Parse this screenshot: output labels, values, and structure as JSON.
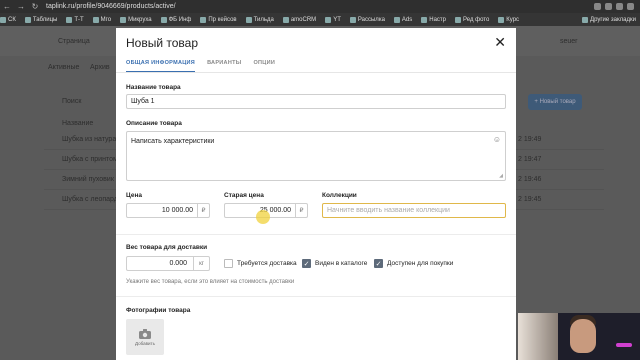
{
  "browser": {
    "url": "taplink.ru/profile/9046669/products/active/",
    "bookmarks": [
      "СК",
      "Таблицы",
      "Т-Т",
      "Мго",
      "Микруха",
      "ФБ Инф",
      "Пр кейсов",
      "Тильда",
      "amoCRM",
      "YT",
      "Рассылка",
      "Ads",
      "Настр",
      "Ред фото",
      "Курс"
    ],
    "other_bookmarks": "Другие закладки"
  },
  "background_app": {
    "nav_pages": "Страница",
    "user": "seuer",
    "tabs": [
      "Активные",
      "Архив"
    ],
    "search_placeholder": "Поиск",
    "new_product_button": "+ Новый товар",
    "column_name": "Название",
    "rows": [
      {
        "name": "Шубка из натурально",
        "date": "2 19:49"
      },
      {
        "name": "Шубка с принтом",
        "date": "2 19:47"
      },
      {
        "name": "Зимний пуховик с",
        "date": "2 19:46"
      },
      {
        "name": "Шубка с леопардо",
        "date": "2 19:45"
      }
    ]
  },
  "modal": {
    "title": "Новый товар",
    "tabs": [
      {
        "label": "ОБЩАЯ ИНФОРМАЦИЯ",
        "active": true
      },
      {
        "label": "ВАРИАНТЫ",
        "active": false
      },
      {
        "label": "ОПЦИИ",
        "active": false
      }
    ],
    "name_label": "Название товара",
    "name_value": "Шуба 1",
    "description_label": "Описание товара",
    "description_value": "Написать характеристики",
    "price_label": "Цена",
    "price_value": "10 000.00",
    "currency": "₽",
    "old_price_label": "Старая цена",
    "old_price_value": "25 000.00",
    "collections_label": "Коллекции",
    "collections_placeholder": "Начните вводить название коллекции",
    "weight_label": "Вес товара для доставки",
    "weight_value": "0.000",
    "weight_unit": "кг",
    "checkboxes": [
      {
        "label": "Требуется доставка",
        "checked": false
      },
      {
        "label": "Виден в каталоге",
        "checked": true
      },
      {
        "label": "Доступен для покупки",
        "checked": true
      }
    ],
    "weight_hint": "Укажите вес товара, если это влияет на стоимость доставки",
    "photos_label": "Фотографии товара",
    "add_photo_label": "Добавить"
  },
  "colors": {
    "accent": "#3a6fb0",
    "focus_border": "#e0b84a",
    "checkbox_checked": "#5d6a7a"
  }
}
